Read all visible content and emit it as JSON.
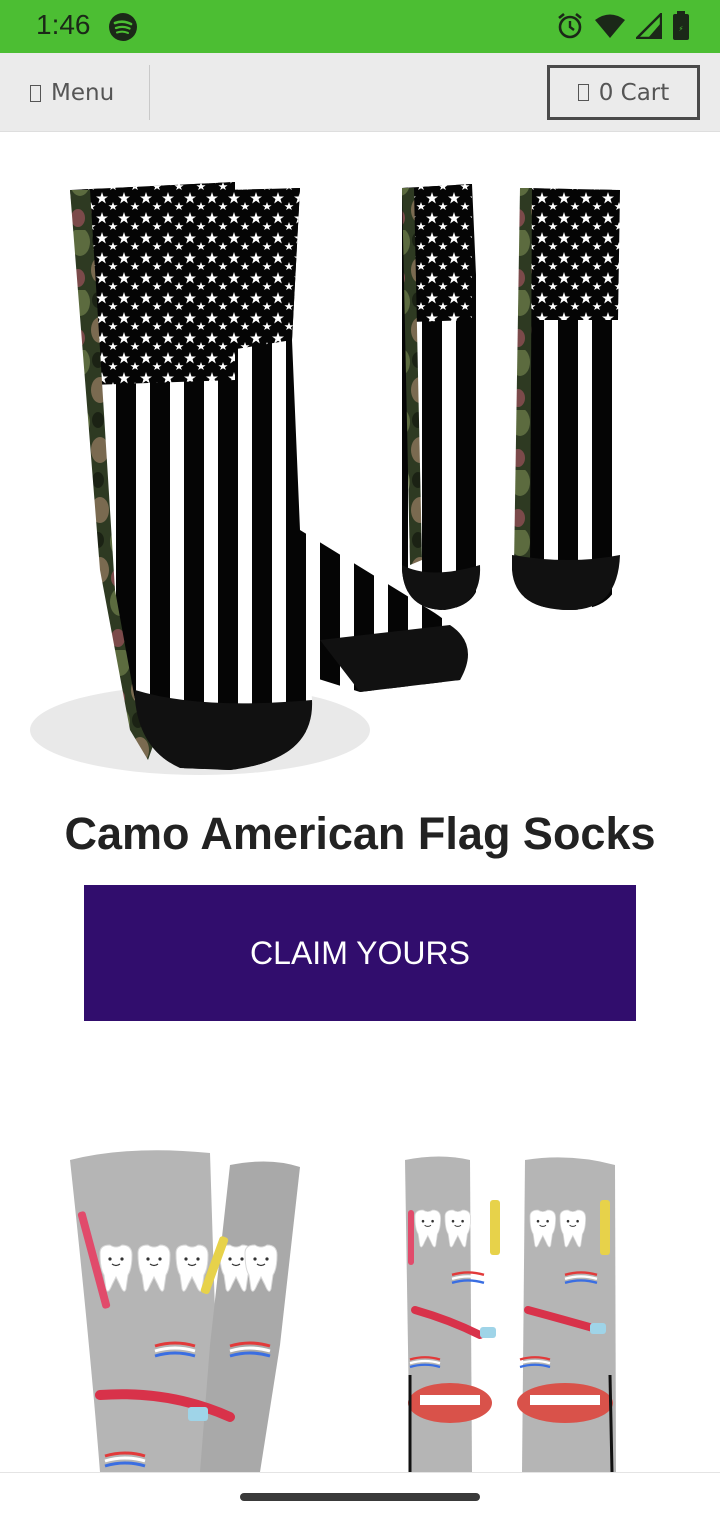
{
  "status_bar": {
    "time": "1:46",
    "icons": [
      "spotify-icon",
      "alarm-icon",
      "wifi-icon",
      "signal-icon",
      "battery-icon"
    ],
    "background": "#4cbe33"
  },
  "nav": {
    "menu_label": "Menu",
    "menu_icon": "menu-icon",
    "cart_label": "0 Cart",
    "cart_icon": "cart-icon"
  },
  "products": [
    {
      "title": "Camo American Flag Socks",
      "button_label": "CLAIM YOURS",
      "button_color": "#310d6d",
      "image": "camo-american-flag-socks-image"
    },
    {
      "title": "",
      "image": "toothbrush-teeth-socks-image"
    }
  ]
}
